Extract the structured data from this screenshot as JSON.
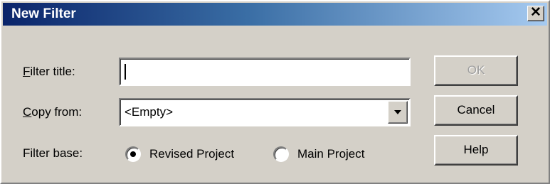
{
  "window": {
    "title": "New Filter",
    "close_glyph": "✕"
  },
  "form": {
    "filter_title": {
      "label_mnemonic": "F",
      "label_rest": "ilter title:",
      "value": ""
    },
    "copy_from": {
      "label_mnemonic": "C",
      "label_rest": "opy from:",
      "value": "<Empty>"
    },
    "filter_base": {
      "label": "Filter base:",
      "options": [
        {
          "label": "Revised Project",
          "checked": true
        },
        {
          "label": "Main Project",
          "checked": false
        }
      ]
    }
  },
  "buttons": {
    "ok": {
      "label": "OK",
      "enabled": false
    },
    "cancel": {
      "label": "Cancel",
      "enabled": true
    },
    "help": {
      "label": "Help",
      "enabled": true
    }
  },
  "colors": {
    "face": "#d4d0c8",
    "title_start": "#0a246a",
    "title_end": "#a6caf0"
  }
}
